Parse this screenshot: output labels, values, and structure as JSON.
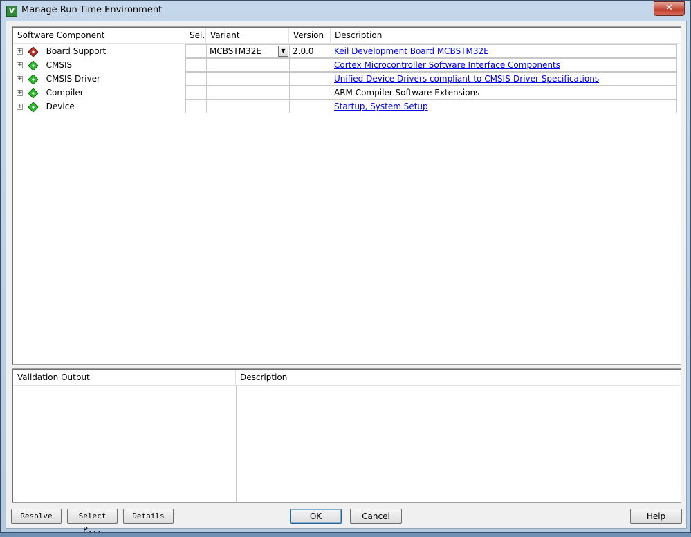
{
  "window": {
    "title": "Manage Run-Time Environment",
    "close_label": "✕"
  },
  "components_table": {
    "headers": {
      "component": "Software Component",
      "sel": "Sel.",
      "variant": "Variant",
      "version": "Version",
      "description": "Description"
    },
    "rows": [
      {
        "name": "Board Support",
        "icon_color": "#b8332e",
        "variant": "MCBSTM32E",
        "version": "2.0.0",
        "description": "Keil Development Board MCBSTM32E",
        "description_is_link": true
      },
      {
        "name": "CMSIS",
        "icon_color": "#2dbb2d",
        "variant": "",
        "version": "",
        "description": "Cortex Microcontroller Software Interface Components",
        "description_is_link": true
      },
      {
        "name": "CMSIS Driver",
        "icon_color": "#2dbb2d",
        "variant": "",
        "version": "",
        "description": "Unified Device Drivers compliant to CMSIS-Driver Specifications",
        "description_is_link": true
      },
      {
        "name": "Compiler",
        "icon_color": "#2dbb2d",
        "variant": "",
        "version": "",
        "description": "ARM Compiler Software Extensions",
        "description_is_link": false
      },
      {
        "name": "Device",
        "icon_color": "#2dbb2d",
        "variant": "",
        "version": "",
        "description": "Startup, System Setup",
        "description_is_link": true
      }
    ]
  },
  "validation": {
    "output_header": "Validation Output",
    "description_header": "Description"
  },
  "buttons": {
    "resolve": "Resolve",
    "select_packs": "Select P...",
    "details": "Details",
    "ok": "OK",
    "cancel": "Cancel",
    "help": "Help"
  }
}
